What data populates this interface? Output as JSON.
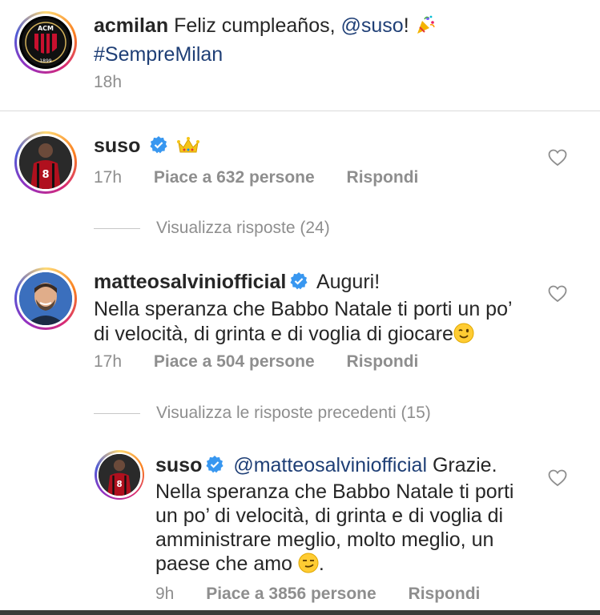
{
  "caption": {
    "username": "acmilan",
    "text": "Feliz cumpleaños,",
    "mention": "@suso",
    "text_end": "!",
    "hashtag": "#SempreMilan",
    "time": "18h"
  },
  "comments": [
    {
      "username": "suso",
      "verified": true,
      "emoji": "crown",
      "time": "17h",
      "likes": "Piace a 632 persone",
      "reply": "Rispondi",
      "view_replies": "Visualizza risposte (24)"
    },
    {
      "username": "matteosalviniofficial",
      "verified": true,
      "line1": "Auguri!",
      "line2": "Nella speranza che Babbo Natale ti porti un po’",
      "line3": "di velocità, di grinta e di voglia di giocare",
      "emoji": "winking-face",
      "time": "17h",
      "likes": "Piace a 504 persone",
      "reply": "Rispondi",
      "view_replies": "Visualizza le risposte precedenti (15)"
    },
    {
      "username": "suso",
      "verified": true,
      "mention": "@matteosalviniofficial",
      "line1_end": "Grazie.",
      "line2": "Nella speranza che Babbo Natale ti porti",
      "line3": "un po’ di velocità, di grinta e di voglia di",
      "line4": "amministrare meglio, molto meglio, un",
      "line5": "paese che amo",
      "line5_end": ".",
      "emoji": "smirking-face",
      "time": "9h",
      "likes": "Piace a 3856 persone",
      "reply": "Rispondi"
    }
  ],
  "colors": {
    "mention": "#1f3f76",
    "verified": "#3897f0",
    "meta": "#8e8e8e"
  }
}
